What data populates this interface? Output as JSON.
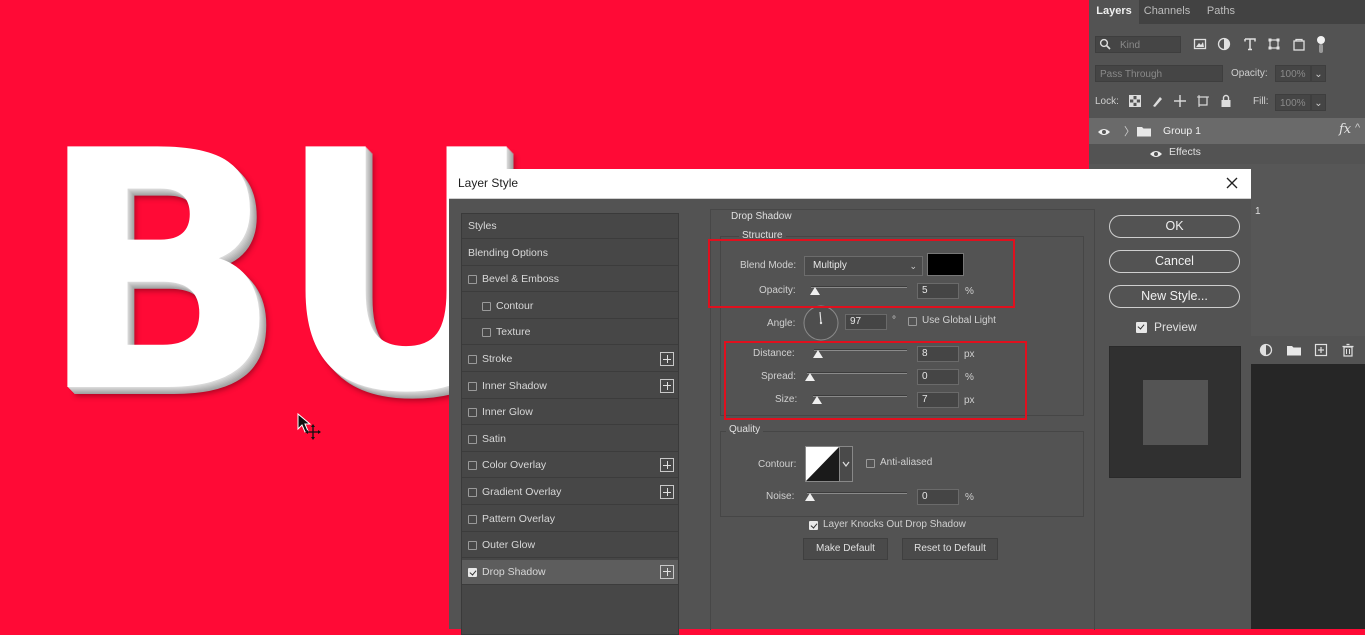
{
  "canvas": {
    "text": "BU",
    "background_color": "#ff0a36"
  },
  "layers_panel": {
    "tabs": [
      "Layers",
      "Channels",
      "Paths"
    ],
    "filter_placeholder": "Kind",
    "blend_mode": "Pass Through",
    "opacity_label": "Opacity:",
    "opacity_value": "100%",
    "lock_label": "Lock:",
    "fill_label": "Fill:",
    "fill_value": "100%",
    "layer_name": "Group 1",
    "fx_label": "fx",
    "effects_label": "Effects",
    "partial_text": "1"
  },
  "dialog": {
    "title": "Layer Style",
    "styles_list": [
      {
        "label": "Styles",
        "checkbox": false,
        "plus": false,
        "indent": false,
        "checked": false
      },
      {
        "label": "Blending Options",
        "checkbox": false,
        "plus": false,
        "indent": false,
        "checked": false
      },
      {
        "label": "Bevel & Emboss",
        "checkbox": true,
        "plus": false,
        "indent": false,
        "checked": false
      },
      {
        "label": "Contour",
        "checkbox": true,
        "plus": false,
        "indent": true,
        "checked": false
      },
      {
        "label": "Texture",
        "checkbox": true,
        "plus": false,
        "indent": true,
        "checked": false
      },
      {
        "label": "Stroke",
        "checkbox": true,
        "plus": true,
        "indent": false,
        "checked": false
      },
      {
        "label": "Inner Shadow",
        "checkbox": true,
        "plus": true,
        "indent": false,
        "checked": false
      },
      {
        "label": "Inner Glow",
        "checkbox": true,
        "plus": false,
        "indent": false,
        "checked": false
      },
      {
        "label": "Satin",
        "checkbox": true,
        "plus": false,
        "indent": false,
        "checked": false
      },
      {
        "label": "Color Overlay",
        "checkbox": true,
        "plus": true,
        "indent": false,
        "checked": false
      },
      {
        "label": "Gradient Overlay",
        "checkbox": true,
        "plus": true,
        "indent": false,
        "checked": false
      },
      {
        "label": "Pattern Overlay",
        "checkbox": true,
        "plus": false,
        "indent": false,
        "checked": false
      },
      {
        "label": "Outer Glow",
        "checkbox": true,
        "plus": false,
        "indent": false,
        "checked": false
      },
      {
        "label": "Drop Shadow",
        "checkbox": true,
        "plus": true,
        "indent": false,
        "checked": true,
        "selected": true
      }
    ],
    "section_title": "Drop Shadow",
    "structure_title": "Structure",
    "blend_mode_label": "Blend Mode:",
    "blend_mode_value": "Multiply",
    "shadow_color": "#000000",
    "opacity_label": "Opacity:",
    "opacity_value": "5",
    "opacity_unit": "%",
    "angle_label": "Angle:",
    "angle_value": "97",
    "angle_unit": "°",
    "use_global_light_label": "Use Global Light",
    "use_global_light_checked": false,
    "distance_label": "Distance:",
    "distance_value": "8",
    "distance_unit": "px",
    "spread_label": "Spread:",
    "spread_value": "0",
    "spread_unit": "%",
    "size_label": "Size:",
    "size_value": "7",
    "size_unit": "px",
    "quality_title": "Quality",
    "contour_label": "Contour:",
    "anti_aliased_label": "Anti-aliased",
    "anti_aliased_checked": false,
    "noise_label": "Noise:",
    "noise_value": "0",
    "noise_unit": "%",
    "knocks_out_label": "Layer Knocks Out Drop Shadow",
    "knocks_out_checked": true,
    "make_default_label": "Make Default",
    "reset_default_label": "Reset to Default",
    "ok_label": "OK",
    "cancel_label": "Cancel",
    "new_style_label": "New Style...",
    "preview_label": "Preview",
    "preview_checked": true,
    "highlight_color": "#e0101e"
  }
}
